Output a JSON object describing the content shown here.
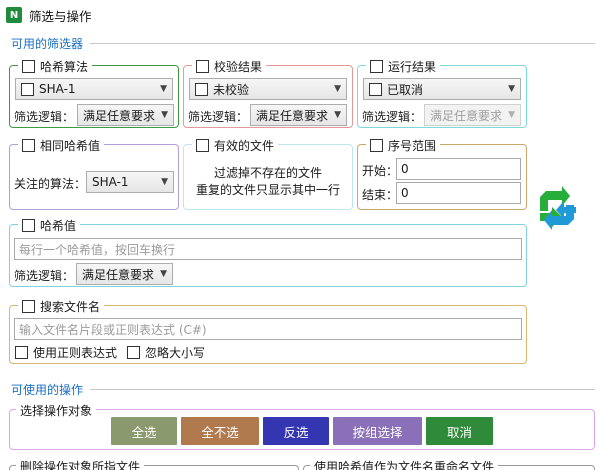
{
  "window": {
    "title": "筛选与操作",
    "icon_letter": "N"
  },
  "filters_section": {
    "label": "可用的筛选器"
  },
  "hash_algorithm": {
    "label": "哈希算法",
    "algorithm": "SHA-1",
    "logic_label": "筛选逻辑：",
    "logic_value": "满足任意要求"
  },
  "verify_result": {
    "label": "校验结果",
    "status": "未校验",
    "logic_label": "筛选逻辑：",
    "logic_value": "满足任意要求"
  },
  "run_result": {
    "label": "运行结果",
    "status": "已取消",
    "logic_label": "筛选逻辑：",
    "logic_value": "满足任意要求"
  },
  "same_hash": {
    "label": "相同哈希值",
    "focus_label": "关注的算法：",
    "algorithm": "SHA-1"
  },
  "valid_file": {
    "label": "有效的文件",
    "description_line1": "过滤掉不存在的文件",
    "description_line2": "重复的文件只显示其中一行"
  },
  "serial_range": {
    "label": "序号范围",
    "start_label": "开始：",
    "start_value": "0",
    "end_label": "结束：",
    "end_value": "0"
  },
  "hash_value": {
    "label": "哈希值",
    "placeholder": "每行一个哈希值，按回车换行",
    "logic_label": "筛选逻辑：",
    "logic_value": "满足任意要求"
  },
  "search_filename": {
    "label": "搜索文件名",
    "placeholder": "输入文件名片段或正则表达式 (C#)",
    "regex_label": "使用正则表达式",
    "ignore_case_label": "忽略大小写"
  },
  "operations_section": {
    "label": "可使用的操作"
  },
  "select_targets": {
    "label": "选择操作对象",
    "buttons": {
      "select_all": "全选",
      "select_none": "全不选",
      "invert": "反选",
      "group_select": "按组选择",
      "cancel": "取消"
    }
  },
  "delete_targets": {
    "label": "删除操作对象所指文件"
  },
  "rename_by_hash": {
    "label": "使用哈希值作为文件名重命名文件"
  },
  "colors": {
    "section_text": "#1a6fc4",
    "hash_algorithm_border": "#3f9a3f",
    "verify_result_border": "#e59a9a",
    "run_result_border": "#7fd9d9",
    "same_hash_border": "#b39ddb",
    "valid_file_border": "#bfe6ef",
    "serial_range_border": "#c9a76a",
    "hash_value_border": "#7fd3df",
    "search_filename_border": "#d8b870",
    "select_targets_border": "#d8a8e8",
    "btn_select_all": "#8a9a6e",
    "btn_select_none": "#b07a4e",
    "btn_invert": "#3336b0",
    "btn_group_select": "#8a70b8",
    "btn_cancel": "#2f8a3a"
  },
  "icons": {
    "refresh": "refresh-arrows-icon",
    "dropdown": "chevron-down-icon"
  }
}
